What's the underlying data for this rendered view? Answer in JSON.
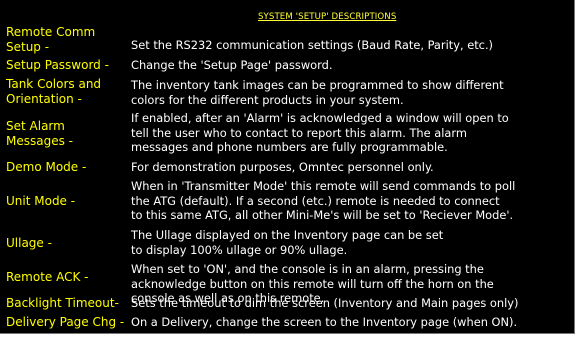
{
  "title": "SYSTEM 'SETUP' DESCRIPTIONS",
  "colors": {
    "background": "#000000",
    "term": "#ffff00",
    "description": "#ffffff"
  },
  "rows": [
    {
      "term": [
        "Remote Comm",
        "Setup -"
      ],
      "desc": [
        "Set the RS232 communication settings (Baud Rate, Parity, etc.)"
      ]
    },
    {
      "term": [
        "Setup Password -"
      ],
      "desc": [
        "Change the 'Setup Page' password."
      ]
    },
    {
      "term": [
        "Tank Colors and",
        "Orientation -"
      ],
      "desc": [
        "The inventory tank images can be programmed to show different",
        "colors for the different products in your system."
      ]
    },
    {
      "term": [
        "Set Alarm",
        "Messages -"
      ],
      "desc": [
        "If enabled, after an 'Alarm' is acknowledged a window will open to",
        "tell the user who to contact to report this alarm. The alarm",
        "messages and phone numbers are fully programmable."
      ]
    },
    {
      "term": [
        "Demo Mode -"
      ],
      "desc": [
        "For demonstration purposes, Omntec personnel only."
      ]
    },
    {
      "term": [
        "Unit Mode -"
      ],
      "desc": [
        "When in 'Transmitter Mode' this remote will send commands to poll",
        "the ATG (default). If a second (etc.) remote is needed to connect",
        "to this same ATG, all other Mini-Me's will be set to 'Reciever Mode'."
      ]
    },
    {
      "term": [
        "Ullage -"
      ],
      "desc": [
        "The Ullage displayed on the Inventory page can be set",
        "to display 100% ullage or 90% ullage."
      ]
    },
    {
      "term": [
        "Remote ACK -"
      ],
      "desc": [
        "When set to 'ON', and the console is in an alarm, pressing the",
        "acknowledge button on this remote will turn off the horn on the",
        "console as well as on this remote."
      ]
    },
    {
      "term": [
        "Backlight Timeout-"
      ],
      "desc": [
        "Sets the timeout to dim the screen (Inventory and Main pages only)"
      ]
    },
    {
      "term": [
        "Delivery Page Chg -"
      ],
      "desc": [
        "On a Delivery, change the screen to the Inventory page (when ON)."
      ]
    }
  ]
}
